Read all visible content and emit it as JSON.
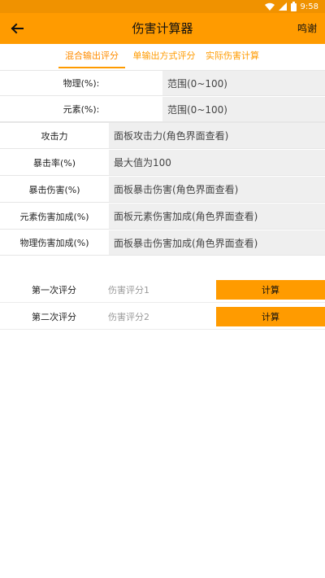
{
  "status_bar": {
    "time": "9:58"
  },
  "app_bar": {
    "title": "伤害计算器",
    "thanks_label": "鸣谢"
  },
  "tabs": [
    {
      "label": "混合输出评分"
    },
    {
      "label": "单输出方式评分"
    },
    {
      "label": "实际伤害计算"
    }
  ],
  "form_top": [
    {
      "label": "物理(%):",
      "placeholder": "范围(0~100)"
    },
    {
      "label": "元素(%):",
      "placeholder": "范围(0~100)"
    }
  ],
  "form_main": [
    {
      "label": "攻击力",
      "placeholder": "面板攻击力(角色界面查看)"
    },
    {
      "label": "暴击率(%)",
      "placeholder": "最大值为100"
    },
    {
      "label": "暴击伤害(%)",
      "placeholder": "面板暴击伤害(角色界面查看)"
    },
    {
      "label": "元素伤害加成(%)",
      "placeholder": "面板元素伤害加成(角色界面查看)"
    },
    {
      "label": "物理伤害加成(%)",
      "placeholder": "面板暴击伤害加成(角色界面查看)"
    }
  ],
  "scores": [
    {
      "label": "第一次评分",
      "placeholder": "伤害评分1",
      "button": "计算"
    },
    {
      "label": "第二次评分",
      "placeholder": "伤害评分2",
      "button": "计算"
    }
  ],
  "colors": {
    "accent": "#ff9b00",
    "status_bar": "#f09200",
    "field_bg": "#efefef"
  }
}
